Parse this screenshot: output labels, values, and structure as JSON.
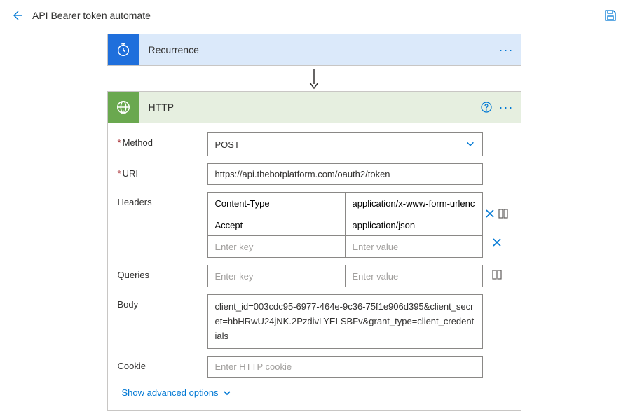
{
  "topbar": {
    "title": "API Bearer token automate"
  },
  "recurrence": {
    "title": "Recurrence"
  },
  "http": {
    "title": "HTTP",
    "fields": {
      "method_label": "Method",
      "method_value": "POST",
      "uri_label": "URI",
      "uri_value": "https://api.thebotplatform.com/oauth2/token",
      "headers_label": "Headers",
      "queries_label": "Queries",
      "body_label": "Body",
      "body_value": "client_id=003cdc95-6977-464e-9c36-75f1e906d395&client_secret=hbHRwU24jNK.2PzdivLYELSBFv&grant_type=client_credentials",
      "cookie_label": "Cookie",
      "cookie_placeholder": "Enter HTTP cookie"
    },
    "headers": [
      {
        "key": "Content-Type",
        "value": "application/x-www-form-urlencoded"
      },
      {
        "key": "Accept",
        "value": "application/json"
      }
    ],
    "kv_placeholders": {
      "key": "Enter key",
      "value": "Enter value"
    },
    "advanced_link": "Show advanced options"
  }
}
